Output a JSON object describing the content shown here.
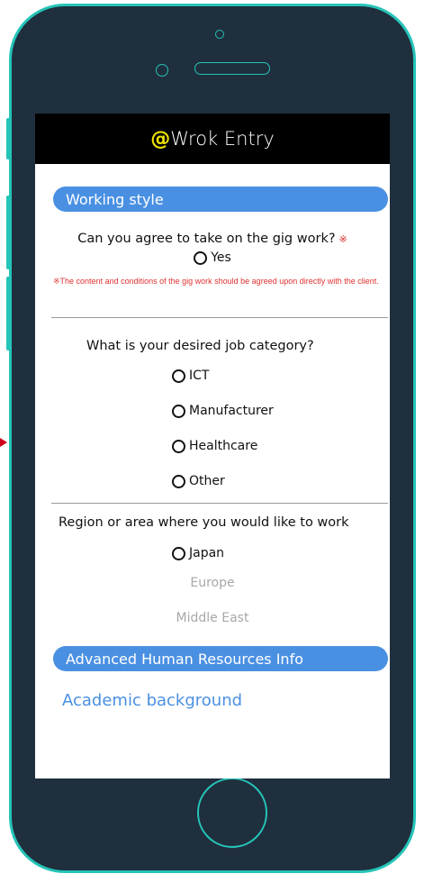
{
  "header": {
    "at_symbol": "@",
    "title": "Wrok Entry"
  },
  "working_style": {
    "section_label": "Working style",
    "question1": "Can you agree to take on the gig work?",
    "required_mark": "※",
    "option_yes": "Yes",
    "note": "※The content and conditions of the gig work should be agreed upon directly with the client.",
    "question2": "What is your desired job category?",
    "job_categories": [
      "ICT",
      "Manufacturer",
      "Healthcare",
      "Other"
    ],
    "question3": "Region or area where you would like to work",
    "region_selected": "Japan",
    "region_other": [
      "Europe",
      "Middle East"
    ]
  },
  "advanced": {
    "section_label": "Advanced Human Resources Info",
    "subheading": "Academic background"
  },
  "colors": {
    "phone_body": "#1f2f3d",
    "phone_accent": "#25c4b8",
    "section_blue": "#4a90e2",
    "at_yellow": "#f2e600",
    "required_red": "#e03030"
  }
}
